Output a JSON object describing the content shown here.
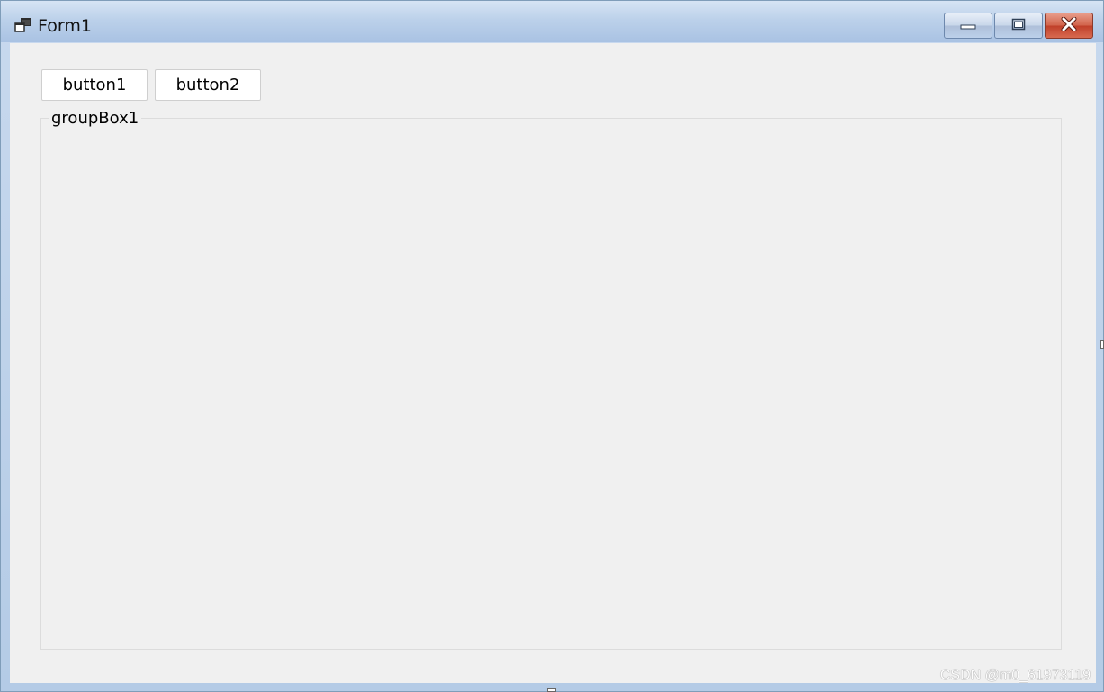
{
  "window": {
    "title": "Form1",
    "icon": "windows-form-icon",
    "controls": {
      "minimize_icon": "minimize-icon",
      "maximize_icon": "maximize-icon",
      "close_icon": "close-icon"
    }
  },
  "form": {
    "button1_label": "button1",
    "button2_label": "button2",
    "groupbox_label": "groupBox1"
  },
  "watermark": {
    "text": "CSDN @m0_61973119"
  },
  "colors": {
    "titlebar": "#a9c2e3",
    "client_background": "#f0f0f0",
    "close_button": "#c0402a",
    "button_background": "#ffffff"
  }
}
